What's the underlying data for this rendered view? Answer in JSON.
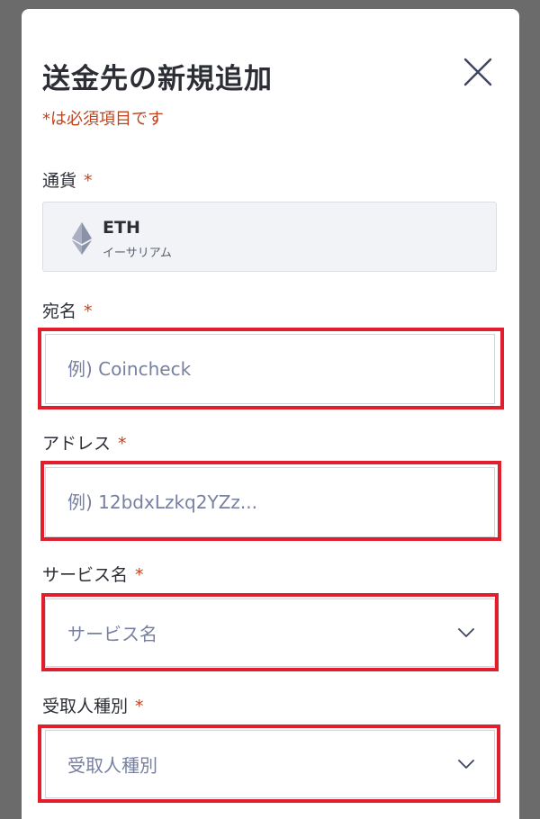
{
  "dialog": {
    "title": "送金先の新規追加",
    "required_note": "*は必須項目です"
  },
  "currency": {
    "label": "通貨",
    "code": "ETH",
    "name": "イーサリアム",
    "icon": "ethereum-icon"
  },
  "fields": {
    "recipient_name": {
      "label": "宛名",
      "placeholder": "例) Coincheck"
    },
    "address": {
      "label": "アドレス",
      "placeholder": "例) 12bdxLzkq2YZz..."
    },
    "service_name": {
      "label": "サービス名",
      "selected": "サービス名"
    },
    "recipient_type": {
      "label": "受取人種別",
      "selected": "受取人種別"
    }
  },
  "required_mark": "*",
  "colors": {
    "required": "#c0431f",
    "highlight": "#e11e2b",
    "placeholder": "#7780a0",
    "overlay": "#6b6b6b"
  }
}
